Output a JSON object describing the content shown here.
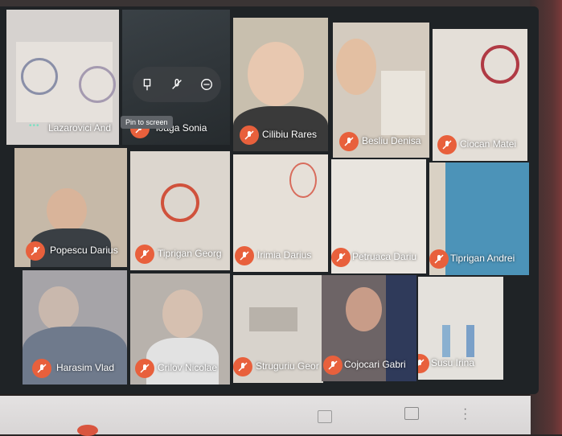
{
  "participants": [
    {
      "name": "Lazarovici And",
      "muted": false,
      "speaking": true
    },
    {
      "name": "loaga Sonia",
      "muted": true,
      "hovered": true
    },
    {
      "name": "Cilibiu Rares",
      "muted": true
    },
    {
      "name": "Besliu Denisa",
      "muted": true
    },
    {
      "name": "Ciocan Matei",
      "muted": true
    },
    {
      "name": "Popescu Darius",
      "muted": true
    },
    {
      "name": "Tiprigan Georg",
      "muted": true
    },
    {
      "name": "Irimia Darius",
      "muted": true
    },
    {
      "name": "Petruaca Dariu",
      "muted": true
    },
    {
      "name": "Tiprigan Andrei",
      "muted": true
    },
    {
      "name": "Harasim Vlad",
      "muted": true
    },
    {
      "name": "Crilov Nicolae",
      "muted": true
    },
    {
      "name": "Struguriu Geor",
      "muted": true
    },
    {
      "name": "Cojocari Gabri",
      "muted": true
    },
    {
      "name": "Susu Irina",
      "muted": true
    }
  ],
  "tile_overlay": {
    "tooltip": "Pin to screen",
    "controls": [
      "pin-icon",
      "mic-off-icon",
      "remove-icon"
    ]
  },
  "speaking_indicator": "•••",
  "colors": {
    "mic_muted": "#e8603c",
    "overlay": "#3c4043",
    "speaking": "#7ee0c2"
  }
}
